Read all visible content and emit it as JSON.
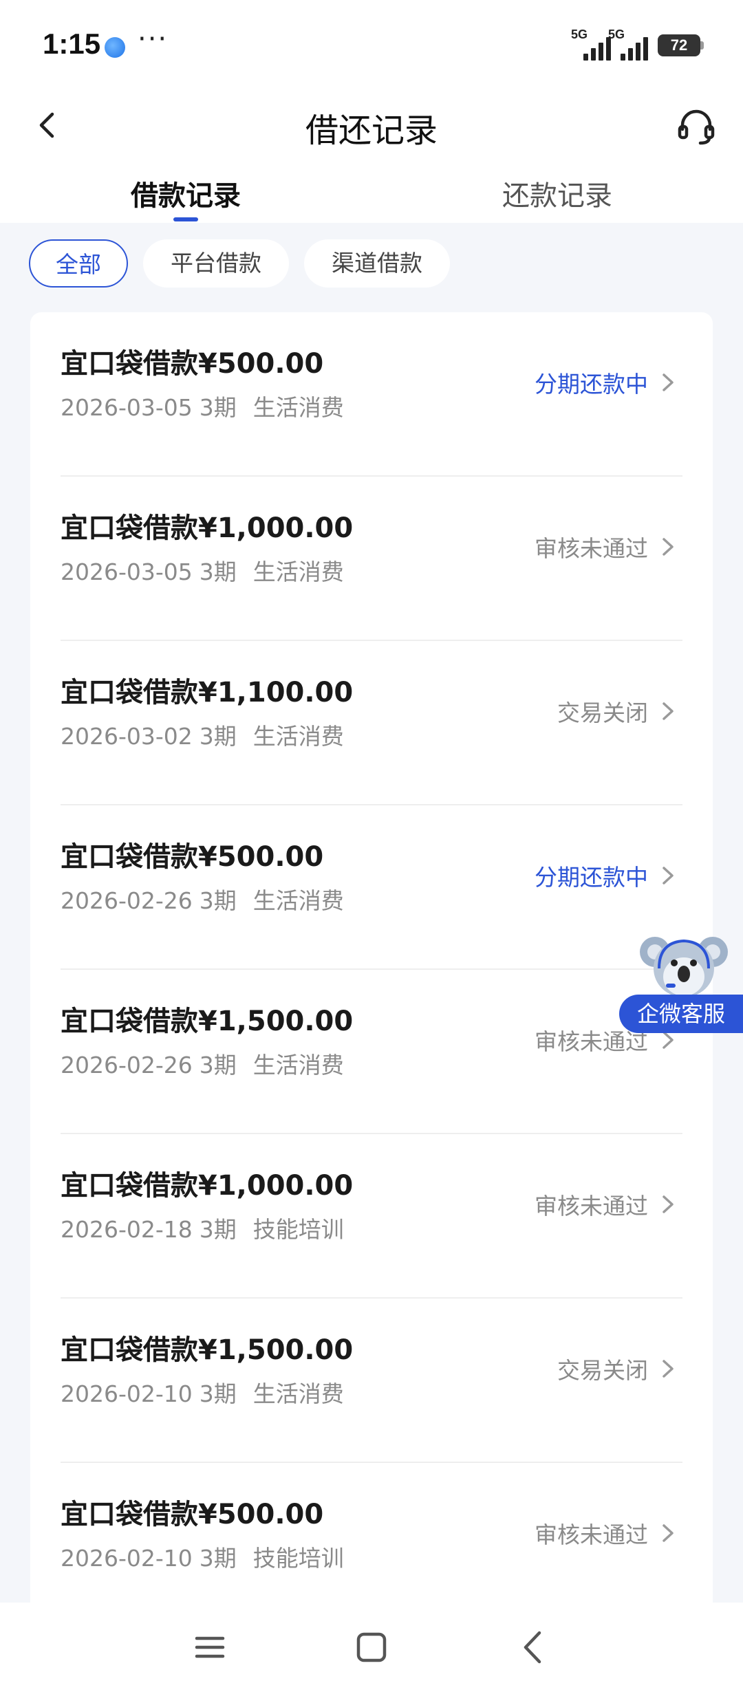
{
  "status_bar": {
    "time": "1:15",
    "more": "···",
    "signal_1": "5G",
    "signal_2": "5G",
    "battery": "72"
  },
  "header": {
    "title": "借还记录",
    "back_icon": "chevron-left-icon",
    "service_icon": "headset-icon"
  },
  "tabs": [
    {
      "label": "借款记录",
      "active": true
    },
    {
      "label": "还款记录",
      "active": false
    }
  ],
  "filters": [
    {
      "label": "全部",
      "active": true
    },
    {
      "label": "平台借款",
      "active": false
    },
    {
      "label": "渠道借款",
      "active": false
    }
  ],
  "records": [
    {
      "title": "宜口袋借款¥500.00",
      "date": "2026-03-05",
      "term": "3期",
      "purpose": "生活消费",
      "status": "分期还款中",
      "status_color": "#2c54d6"
    },
    {
      "title": "宜口袋借款¥1,000.00",
      "date": "2026-03-05",
      "term": "3期",
      "purpose": "生活消费",
      "status": "审核未通过",
      "status_color": "#8a8a8a"
    },
    {
      "title": "宜口袋借款¥1,100.00",
      "date": "2026-03-02",
      "term": "3期",
      "purpose": "生活消费",
      "status": "交易关闭",
      "status_color": "#8a8a8a"
    },
    {
      "title": "宜口袋借款¥500.00",
      "date": "2026-02-26",
      "term": "3期",
      "purpose": "生活消费",
      "status": "分期还款中",
      "status_color": "#2c54d6"
    },
    {
      "title": "宜口袋借款¥1,500.00",
      "date": "2026-02-26",
      "term": "3期",
      "purpose": "生活消费",
      "status": "审核未通过",
      "status_color": "#8a8a8a"
    },
    {
      "title": "宜口袋借款¥1,000.00",
      "date": "2026-02-18",
      "term": "3期",
      "purpose": "技能培训",
      "status": "审核未通过",
      "status_color": "#8a8a8a"
    },
    {
      "title": "宜口袋借款¥1,500.00",
      "date": "2026-02-10",
      "term": "3期",
      "purpose": "生活消费",
      "status": "交易关闭",
      "status_color": "#8a8a8a"
    },
    {
      "title": "宜口袋借款¥500.00",
      "date": "2026-02-10",
      "term": "3期",
      "purpose": "技能培训",
      "status": "审核未通过",
      "status_color": "#8a8a8a"
    }
  ],
  "floating_service": {
    "label": "企微客服",
    "icon": "koala-mascot-icon"
  },
  "nav_bar": {
    "menu_icon": "menu-icon",
    "home_icon": "home-square-icon",
    "back_icon": "back-triangle-icon"
  },
  "colors": {
    "accent": "#2c54d6",
    "muted": "#8a8a8a",
    "background": "#f4f6fa"
  }
}
